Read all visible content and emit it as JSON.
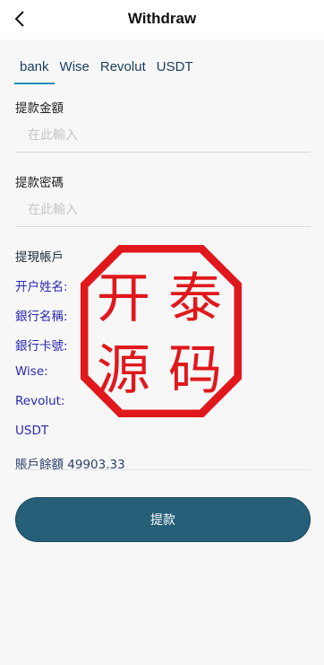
{
  "header": {
    "title": "Withdraw"
  },
  "tabs": [
    {
      "label": "bank",
      "active": true
    },
    {
      "label": "Wise",
      "active": false
    },
    {
      "label": "Revolut",
      "active": false
    },
    {
      "label": "USDT",
      "active": false
    }
  ],
  "form": {
    "amount": {
      "label": "提款金額",
      "placeholder": "在此輸入"
    },
    "password": {
      "label": "提款密碼",
      "placeholder": "在此輸入"
    }
  },
  "account": {
    "heading": "提現帳戶",
    "holder_name": "开户姓名:",
    "bank_name": "銀行名稱:",
    "card_number": "銀行卡號:",
    "wise": "Wise:",
    "revolut": "Revolut:",
    "usdt": "USDT",
    "balance": "賬戶餘額 49903.33"
  },
  "submit_label": "提款",
  "watermark": {
    "text": [
      "开",
      "泰",
      "源",
      "码"
    ],
    "color": "#e0181c"
  },
  "colors": {
    "accent": "#1e8fb8",
    "button": "#255f78",
    "link_blue": "#2a2ab0"
  }
}
